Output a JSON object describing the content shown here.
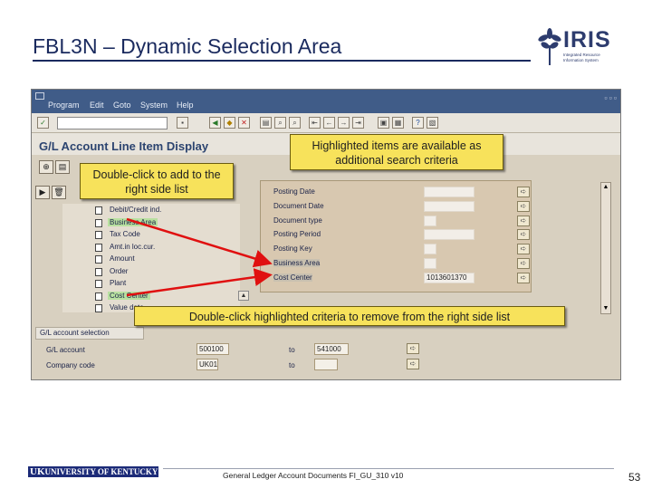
{
  "slide": {
    "title": "FBL3N – Dynamic Selection Area",
    "logo_text": "IRIS",
    "logo_tagline": "Integrated Resource Information System",
    "page_number": "53",
    "footer_text": "General Ledger Account Documents FI_GU_310 v10",
    "university": "UNIVERSITY OF KENTUCKY"
  },
  "sap": {
    "menu": [
      "Program",
      "Edit",
      "Goto",
      "System",
      "Help"
    ],
    "screen_title": "G/L Account Line Item Display",
    "field_list": [
      {
        "label": "Debit/Credit ind.",
        "highlighted": false
      },
      {
        "label": "Business Area",
        "highlighted": true
      },
      {
        "label": "Tax Code",
        "highlighted": false
      },
      {
        "label": "Amt.in loc.cur.",
        "highlighted": false
      },
      {
        "label": "Amount",
        "highlighted": false
      },
      {
        "label": "Order",
        "highlighted": false
      },
      {
        "label": "Plant",
        "highlighted": false
      },
      {
        "label": "Cost Center",
        "highlighted": true
      },
      {
        "label": "Value date",
        "highlighted": false
      }
    ],
    "dynamic_criteria": [
      {
        "label": "Posting Date",
        "value": "",
        "highlighted": false
      },
      {
        "label": "Document Date",
        "value": "",
        "highlighted": false
      },
      {
        "label": "Document type",
        "value": "",
        "highlighted": false
      },
      {
        "label": "Posting Period",
        "value": "",
        "highlighted": false
      },
      {
        "label": "Posting Key",
        "value": "",
        "highlighted": false
      },
      {
        "label": "Business Area",
        "value": "",
        "highlighted": true
      },
      {
        "label": "Cost Center",
        "value": "1013601370",
        "highlighted": true
      }
    ],
    "gl_selection": {
      "header": "G/L account selection",
      "rows": [
        {
          "label": "G/L account",
          "from": "500100",
          "to_label": "to",
          "to": "541000"
        },
        {
          "label": "Company code",
          "from": "UK01",
          "to_label": "to",
          "to": ""
        }
      ]
    }
  },
  "callouts": {
    "add": "Double-click to add to the right side list",
    "available": "Highlighted items are available as additional search criteria",
    "remove": "Double-click highlighted criteria to remove from the right side list"
  },
  "colors": {
    "callout": "#f7e25b",
    "arrow": "#e01010",
    "highlight": "#b8e0a0",
    "menubar": "#405c88"
  }
}
